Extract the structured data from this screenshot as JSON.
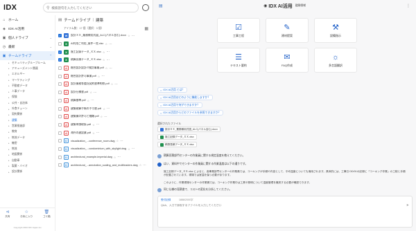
{
  "app": {
    "logo": "IDX"
  },
  "search": {
    "placeholder": "検索語句を入力してください"
  },
  "sidebar": {
    "items": [
      {
        "label": "ホーム",
        "icon": "home-icon"
      },
      {
        "label": "IDX AI活用",
        "icon": "ai-icon"
      },
      {
        "label": "個人ドライブ",
        "icon": "drive-icon"
      },
      {
        "label": "最新",
        "icon": "clock-icon"
      },
      {
        "label": "チームドライブ",
        "icon": "team-drive-icon"
      }
    ],
    "sub_items": [
      "セキュリティグループルーム",
      "アミューズメント関連",
      "エネルギー",
      "マーケティング",
      "不動産データ",
      "人事データ",
      "保険",
      "公共・自治体",
      "外食チェーン",
      "契約関係",
      "建築",
      "営業推進部",
      "教育",
      "物流データ",
      "機密",
      "物流",
      "地図関係",
      "自動車",
      "製薬・バイオ",
      "設計関係"
    ],
    "selected_sub": "建築",
    "bottom": [
      {
        "label": "共有",
        "icon": "share-icon"
      },
      {
        "label": "お気に入り",
        "icon": "star-icon"
      },
      {
        "label": "ゴミ箱",
        "icon": "trash-icon"
      }
    ],
    "copyright": "Copyright 2023 IDX Japan Inc."
  },
  "files": {
    "breadcrumb_root": "チームドライブ",
    "breadcrumb_current": "建築",
    "meta": "アイテム数：17 個（選択：3 個）",
    "rows": [
      {
        "name": "設計ＸＸ_業務様用式図_ALC(パネル含む).docx",
        "type": "doc",
        "checked": true
      },
      {
        "name": "AI利用ご利用_案件一覧.xlsx",
        "type": "xls",
        "checked": false
      },
      {
        "name": "施工記録データ_ＸＸ.xlsx",
        "type": "xls",
        "checked": true
      },
      {
        "name": "積算見積データ_ＸＸ.xlsx",
        "type": "xls",
        "checked": true
      },
      {
        "name": "総合設計設計IT検討事業.pdf",
        "type": "pdf",
        "checked": false
      },
      {
        "name": "総合設計許可事業.pdf",
        "type": "pdf",
        "checked": false
      },
      {
        "name": "設計業務等委託契約書準約款.pdf",
        "type": "pdf",
        "checked": false
      },
      {
        "name": "設計仕様書.pdf",
        "type": "pdf",
        "checked": false
      },
      {
        "name": "積算基準.pdf",
        "type": "pdf",
        "checked": false
      },
      {
        "name": "建築積算手帳の手引書.pdf",
        "type": "pdf",
        "checked": false
      },
      {
        "name": "建築業の許可と種類.pdf",
        "type": "pdf",
        "checked": false
      },
      {
        "name": "建築申請取扱.pdf",
        "type": "pdf",
        "checked": false
      },
      {
        "name": "海外の建設業.pdf",
        "type": "pdf",
        "checked": false
      },
      {
        "name": "visualization_...conference_room.dwg",
        "type": "dwg",
        "checked": false
      },
      {
        "name": "visualization_...condominium_with_skylight.dwg",
        "type": "dwg",
        "checked": false
      },
      {
        "name": "architectural_example-imperial.dwg",
        "type": "dwg",
        "checked": false
      },
      {
        "name": "architectural_...annotation_scaling_and_multileaders.dwg",
        "type": "dwg",
        "checked": false
      }
    ]
  },
  "panel": {
    "title": "IDX AI活用",
    "subtitle": "建築領域",
    "cards": [
      {
        "label": "工事工程",
        "icon": "check-list-icon"
      },
      {
        "label": "建材提案",
        "icon": "building-icon"
      },
      {
        "label": "設備指示",
        "icon": "tools-icon"
      },
      {
        "label": "テキスト要約",
        "icon": "text-icon"
      },
      {
        "label": "FAQ作成",
        "icon": "faq-icon"
      },
      {
        "label": "多言語翻訳",
        "icon": "translate-icon"
      }
    ],
    "suggestions": [
      "IDX AI活用 とは？",
      "IDX AI活用はどのように機能しますか？",
      "IDX AI活用で何ができますか？",
      "IDX AI活用からどのファイルを参照できますか？"
    ],
    "selected_files_label": "選択されたファイル",
    "selected_files": [
      {
        "name": "設計ＸＸ_業務様用式図_ALC(パネル含む).docx",
        "type": "doc"
      },
      {
        "name": "施工記録データ_ＸＸ.xlsx",
        "type": "xls"
      },
      {
        "name": "積算見積データ_ＸＸ.xlsx",
        "type": "xls"
      }
    ],
    "q1": "積算見積部門センターの作業員に関する規定温度を教えてください。",
    "a1_head": "はい、資料中でセンターの作業員に関する作業温度は以下の通りです。",
    "a1_body1": "施工記録データ_ＸＸ.xlsx によると、各事業部門センターの作業員では、コーキングが手順や内容として、平均温度についても適用されます。具体的には、工事日 DD/01の記録に「コーキング作業」の工程と手順が記載されています。現場では室温を保つ必要があります。",
    "a1_body2": "このように、作業現場センターの作業員では、コーキング作業中は工具や照明について温度管理を徹底する必要が確認できます。",
    "q2": "同じ仕様の見積書で、コストの変化を分析してください。",
    "input_label": "受付記録",
    "input_count": "1888/2000字",
    "input_placeholder": "Q&A、入力で参照するファイルを入力してください"
  }
}
